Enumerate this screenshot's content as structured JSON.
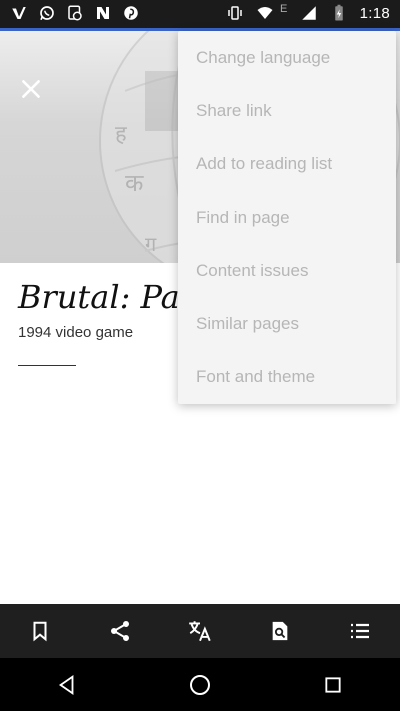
{
  "status_bar": {
    "time": "1:18",
    "network_label": "E",
    "left_icons": [
      "vimeo-icon",
      "whatsapp-icon",
      "sync-icon",
      "notes-icon",
      "pinterest-icon"
    ],
    "right_icons": [
      "vibrate-icon",
      "wifi-icon",
      "signal-icon",
      "battery-icon"
    ]
  },
  "article": {
    "title": "Brutal: Pav",
    "subtitle": "1994 video game"
  },
  "menu": {
    "items": [
      "Change language",
      "Share link",
      "Add to reading list",
      "Find in page",
      "Content issues",
      "Similar pages",
      "Font and theme"
    ]
  },
  "toolbar": {
    "icons": [
      "bookmark-icon",
      "share-icon",
      "translate-icon",
      "find-in-page-icon",
      "contents-list-icon"
    ]
  },
  "nav": {
    "icons": [
      "back-icon",
      "home-icon",
      "recents-icon"
    ]
  },
  "colors": {
    "progress": "#3b64c7",
    "menu_text": "#b6b6b6",
    "toolbar_bg": "#1f1f1f"
  }
}
